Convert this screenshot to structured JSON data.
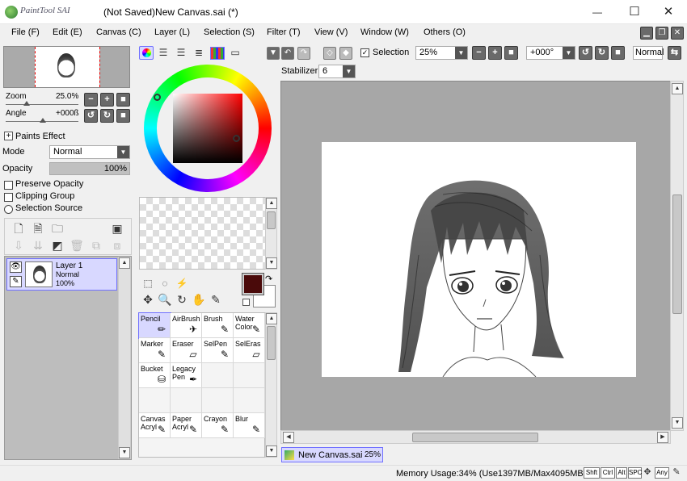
{
  "window": {
    "app_logo_text": "PaintTool SAI",
    "title": "(Not Saved)New Canvas.sai (*)",
    "minimize": "—",
    "maximize": "☐",
    "close": "✕"
  },
  "menu": [
    {
      "label": "File (F)"
    },
    {
      "label": "Edit (E)"
    },
    {
      "label": "Canvas (C)"
    },
    {
      "label": "Layer (L)"
    },
    {
      "label": "Selection (S)"
    },
    {
      "label": "Filter (T)"
    },
    {
      "label": "View (V)"
    },
    {
      "label": "Window (W)"
    },
    {
      "label": "Others (O)"
    }
  ],
  "navigator": {
    "zoom_label": "Zoom",
    "zoom_value": "25.0%",
    "angle_label": "Angle",
    "angle_value": "+000ß"
  },
  "layer_props": {
    "paints_effect": "Paints Effect",
    "mode_label": "Mode",
    "mode_value": "Normal",
    "opacity_label": "Opacity",
    "opacity_value": "100%",
    "opacity_fraction": 1.0,
    "preserve_opacity": "Preserve Opacity",
    "clipping_group": "Clipping Group",
    "selection_source": "Selection Source"
  },
  "layers": [
    {
      "name": "Layer 1",
      "mode": "Normal",
      "opacity": "100%"
    }
  ],
  "color": {
    "current": "#4a0a0a",
    "secondary": "#ffffff"
  },
  "tools": [
    {
      "label": "Pencil",
      "icon": "pencil-icon",
      "glyph": "✏"
    },
    {
      "label": "AirBrush",
      "icon": "airbrush-icon",
      "glyph": "✈"
    },
    {
      "label": "Brush",
      "icon": "brush-icon",
      "glyph": "✎"
    },
    {
      "label": "Water Color",
      "icon": "watercolor-icon",
      "glyph": "✎"
    },
    {
      "label": "Marker",
      "icon": "marker-icon",
      "glyph": "✎"
    },
    {
      "label": "Eraser",
      "icon": "eraser-icon",
      "glyph": "▱"
    },
    {
      "label": "SelPen",
      "icon": "selpen-icon",
      "glyph": "✎"
    },
    {
      "label": "SelEras",
      "icon": "seleras-icon",
      "glyph": "▱"
    },
    {
      "label": "Bucket",
      "icon": "bucket-icon",
      "glyph": "⛁"
    },
    {
      "label": "Legacy Pen",
      "icon": "legacy-pen-icon",
      "glyph": "✒"
    },
    {
      "label": "",
      "icon": "",
      "glyph": ""
    },
    {
      "label": "",
      "icon": "",
      "glyph": ""
    },
    {
      "label": "",
      "icon": "",
      "glyph": ""
    },
    {
      "label": "",
      "icon": "",
      "glyph": ""
    },
    {
      "label": "",
      "icon": "",
      "glyph": ""
    },
    {
      "label": "",
      "icon": "",
      "glyph": ""
    },
    {
      "label": "Canvas Acryl",
      "icon": "canvas-acryl-icon",
      "glyph": "✎"
    },
    {
      "label": "Paper Acryl",
      "icon": "paper-acryl-icon",
      "glyph": "✎"
    },
    {
      "label": "Crayon",
      "icon": "crayon-icon",
      "glyph": "✎"
    },
    {
      "label": "Blur",
      "icon": "blur-icon",
      "glyph": "✎"
    }
  ],
  "toolbar": {
    "selection_label": "Selection",
    "zoom_value": "25%",
    "angle_value": "+000°",
    "blend_mode": "Normal",
    "stabilizer_label": "Stabilizer",
    "stabilizer_value": "6"
  },
  "document_tab": {
    "name": "New Canvas.sai",
    "zoom": "25%"
  },
  "status": {
    "memory": "Memory Usage:34% (Use1397MB/Max4095MB)",
    "keys": [
      "Shft",
      "Ctrl",
      "Alt",
      "SPC",
      "Any"
    ]
  }
}
